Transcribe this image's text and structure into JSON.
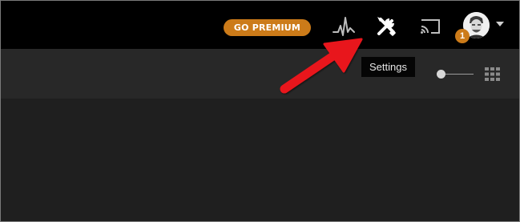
{
  "header": {
    "premium_label": "GO PREMIUM",
    "notification_count": "1",
    "icons": [
      "activity-icon",
      "settings-icon",
      "cast-icon",
      "avatar",
      "chevron-down-icon"
    ]
  },
  "tooltip": {
    "text": "Settings"
  },
  "toolbar": {
    "icons": [
      "zoom-slider",
      "grid-view-icon"
    ]
  },
  "colors": {
    "premium": "#cc7b19",
    "badge": "#cc7b19",
    "annotation_arrow": "#e8141b",
    "topbar_bg": "#000000",
    "toolbar_bg": "#282828",
    "content_bg": "#1f1f1f"
  }
}
